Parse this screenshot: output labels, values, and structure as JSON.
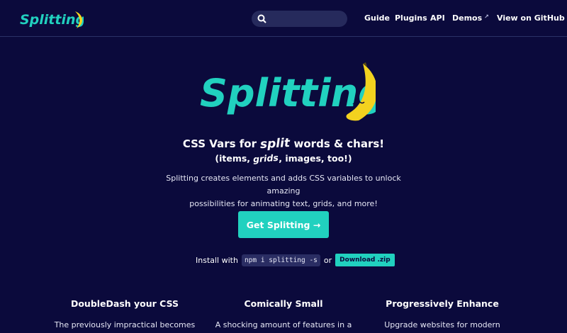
{
  "header": {
    "logo_text": "Splitting",
    "search_placeholder": "",
    "nav": [
      {
        "label": "Guide"
      },
      {
        "label": "Plugins"
      },
      {
        "label": "API"
      },
      {
        "label": "Demos",
        "external": true
      },
      {
        "label": "View on GitHub",
        "external": true
      }
    ]
  },
  "hero": {
    "logo_text": "Splitting",
    "headline_pre": "CSS Vars for ",
    "headline_split": "split",
    "headline_post": " words & chars!",
    "sub_pre": "(items, ",
    "sub_grids": "grids",
    "sub_post": ", images, too!)",
    "desc_line1": "Splitting creates elements and adds CSS variables to unlock amazing",
    "desc_line2": "possibilities for animating text, grids, and more!",
    "cta_label": "Get Splitting →",
    "install_label": "Install with",
    "install_cmd": "npm i splitting -s",
    "install_or": "or",
    "download_label": "Download .zip"
  },
  "features": [
    {
      "title": "DoubleDash your CSS",
      "text": "The previously impractical becomes"
    },
    {
      "title": "Comically Small",
      "text": "A shocking amount of features in a"
    },
    {
      "title": "Progressively Enhance",
      "text": "Upgrade websites for modern"
    }
  ],
  "colors": {
    "background": "#0b0a3c",
    "accent": "#21d1bf",
    "banana": "#f3d21f"
  },
  "icons": {
    "search": "search-icon",
    "external": "external-link-icon",
    "mascot": "banana-icon"
  }
}
